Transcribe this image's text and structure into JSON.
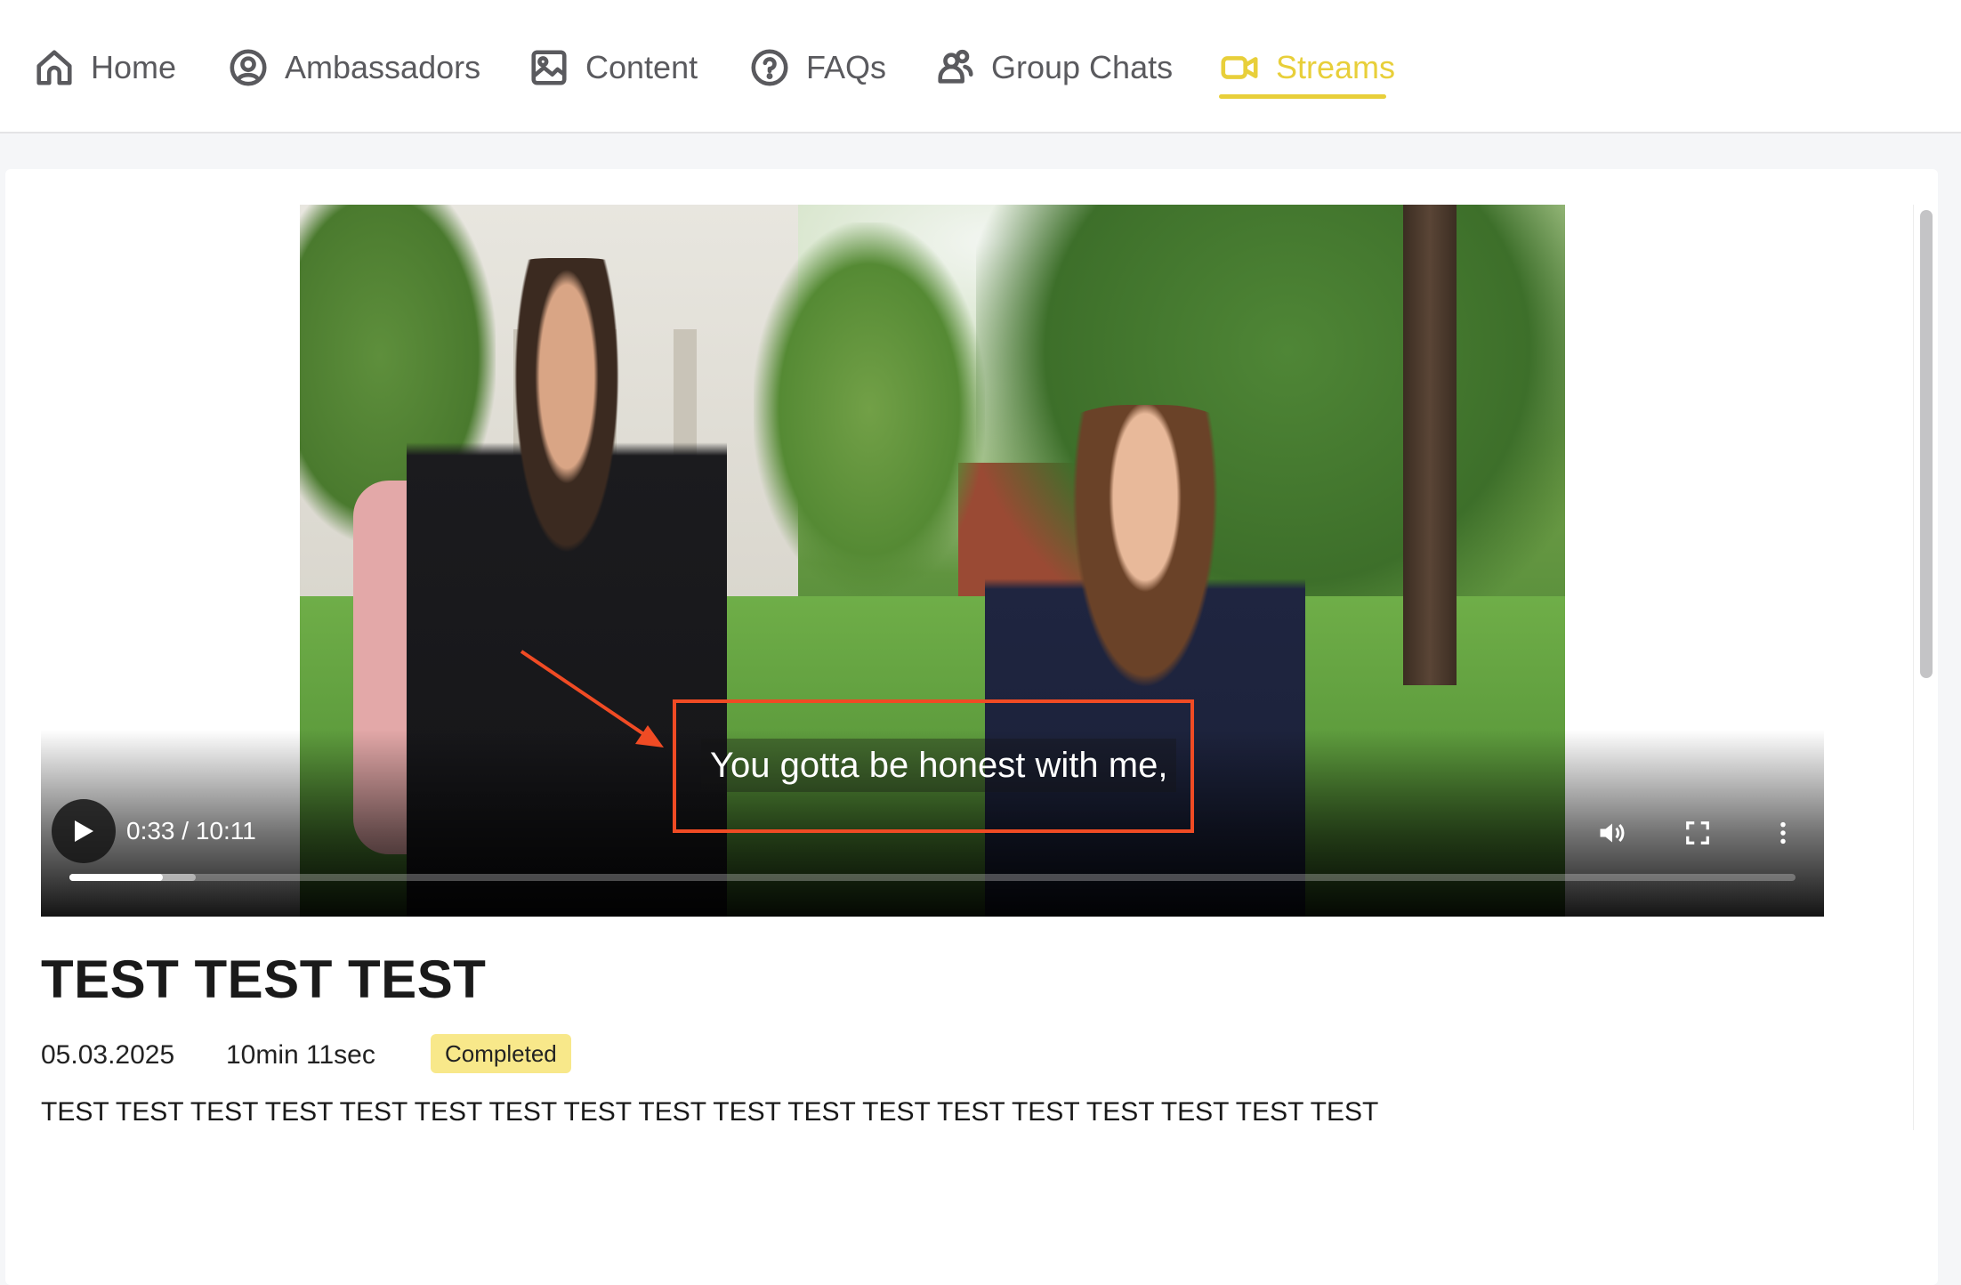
{
  "nav": {
    "items": [
      {
        "label": "Home",
        "icon": "home-icon"
      },
      {
        "label": "Ambassadors",
        "icon": "user-circle-icon"
      },
      {
        "label": "Content",
        "icon": "image-icon"
      },
      {
        "label": "FAQs",
        "icon": "question-icon"
      },
      {
        "label": "Group Chats",
        "icon": "users-icon"
      },
      {
        "label": "Streams",
        "icon": "video-camera-icon",
        "active": true
      }
    ],
    "active_color": "#e8cf3a"
  },
  "player": {
    "time_display": "0:33 / 10:11",
    "current_seconds": 33,
    "duration_seconds": 611,
    "buffered_fraction": 0.073,
    "caption": "You gotta be honest with me,",
    "annotation_color": "#f04b24"
  },
  "stream": {
    "title": "TEST TEST TEST",
    "date": "05.03.2025",
    "duration": "10min 11sec",
    "status": "Completed",
    "status_color": "#f8e88a",
    "description": "TEST TEST TEST TEST TEST TEST TEST TEST TEST TEST TEST TEST TEST TEST TEST TEST TEST TEST"
  }
}
